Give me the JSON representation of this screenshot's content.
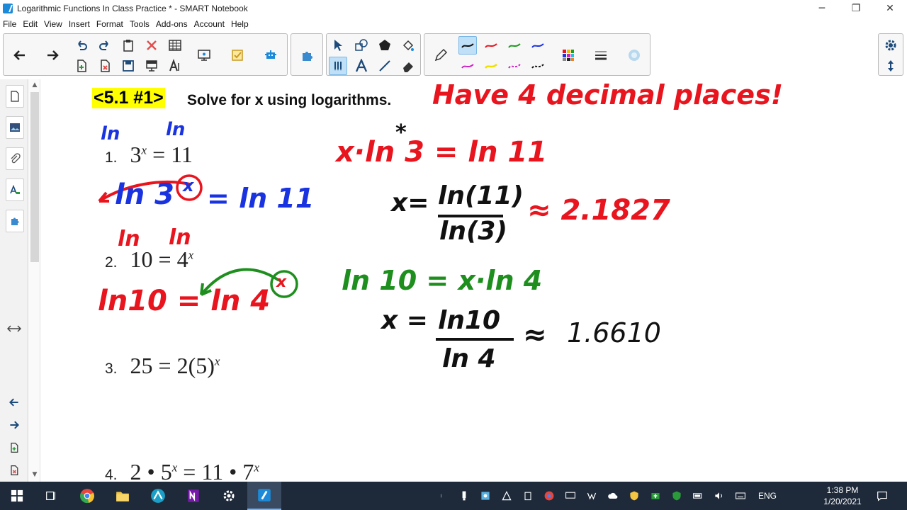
{
  "window": {
    "title": "Logarithmic Functions In Class Practice * - SMART Notebook",
    "minimize_glyph": "─",
    "restore_glyph": "❐",
    "close_glyph": "✕"
  },
  "menu": [
    "File",
    "Edit",
    "View",
    "Insert",
    "Format",
    "Tools",
    "Add-ons",
    "Account",
    "Help"
  ],
  "page": {
    "heading_tag": "<5.1 #1>",
    "heading_text": "Solve for x using logarithms.",
    "problems": [
      {
        "num": "1.",
        "lhs": "3",
        "exp": "x",
        "rhs": " = 11"
      },
      {
        "num": "2.",
        "lhs": "10 = 4",
        "exp": "x",
        "rhs": ""
      },
      {
        "num": "3.",
        "lhs": "25 = 2(5)",
        "exp": "x",
        "rhs": ""
      },
      {
        "num": "4.",
        "lhs": "2 • 5",
        "exp": "x",
        "rhs": " = 11 • 7",
        "exp2": "x"
      }
    ],
    "handwriting": {
      "note": "Have 4 decimal places!",
      "p1_step1": "x·ln 3 = ln 11",
      "p1_ln_a": "ln",
      "p1_ln_b": "ln",
      "p1_rewrite_left": "ln 3",
      "p1_rewrite_x": "x",
      "p1_rewrite_right": "= ln 11",
      "p1_num": "ln(11)",
      "p1_den": "ln(3)",
      "p1_xeq": "x=",
      "p1_answer": "≈ 2.1827",
      "p1_star": "*",
      "p2_ln_a": "ln",
      "p2_ln_b": "ln",
      "p2_rewrite": "ln10 = ln 4",
      "p2_rewrite_x": "x",
      "p2_step1": "ln 10 = x·ln 4",
      "p2_xeq": "x =",
      "p2_num": "ln10",
      "p2_den": "ln 4",
      "p2_approx": "≈",
      "p2_answer": "1.6610"
    }
  },
  "taskbar": {
    "lang": "ENG",
    "time": "1:38 PM",
    "date": "1/20/2021"
  },
  "colors": {
    "red_ink": "#e8141e",
    "blue_ink": "#1a33e0",
    "green_ink": "#1e8f1e",
    "black_ink": "#111111",
    "highlight": "#ffff00",
    "taskbar_bg": "#1e2a3a"
  }
}
